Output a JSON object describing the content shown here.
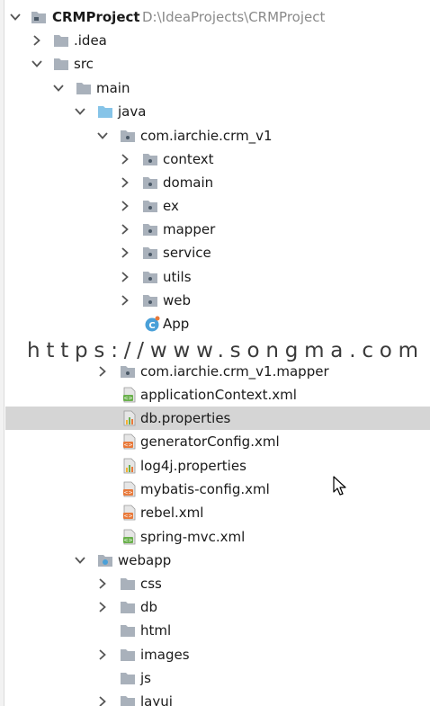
{
  "tree": {
    "root": {
      "name": "CRMProject",
      "path": "D:\\IdeaProjects\\CRMProject"
    },
    "items": [
      {
        "label": "CRMProject"
      },
      {
        "label": ".idea"
      },
      {
        "label": "src"
      },
      {
        "label": "main"
      },
      {
        "label": "java"
      },
      {
        "label": "com.iarchie.crm_v1"
      },
      {
        "label": "context"
      },
      {
        "label": "domain"
      },
      {
        "label": "ex"
      },
      {
        "label": "mapper"
      },
      {
        "label": "service"
      },
      {
        "label": "utils"
      },
      {
        "label": "web"
      },
      {
        "label": "App"
      },
      {
        "label": "com.iarchie.crm_v1.mapper"
      },
      {
        "label": "applicationContext.xml"
      },
      {
        "label": "db.properties"
      },
      {
        "label": "generatorConfig.xml"
      },
      {
        "label": "log4j.properties"
      },
      {
        "label": "mybatis-config.xml"
      },
      {
        "label": "rebel.xml"
      },
      {
        "label": "spring-mvc.xml"
      },
      {
        "label": "webapp"
      },
      {
        "label": "css"
      },
      {
        "label": "db"
      },
      {
        "label": "html"
      },
      {
        "label": "images"
      },
      {
        "label": "js"
      },
      {
        "label": "layui"
      }
    ]
  },
  "watermark": "https://www.songma.com",
  "colors": {
    "selection": "#d5d5d5",
    "folder": "#a9b1bb",
    "source_folder": "#86c4e8",
    "xml": "#e8793a",
    "spring": "#6ab04c",
    "properties": "#f2b233",
    "class": "#4aa0d8"
  }
}
